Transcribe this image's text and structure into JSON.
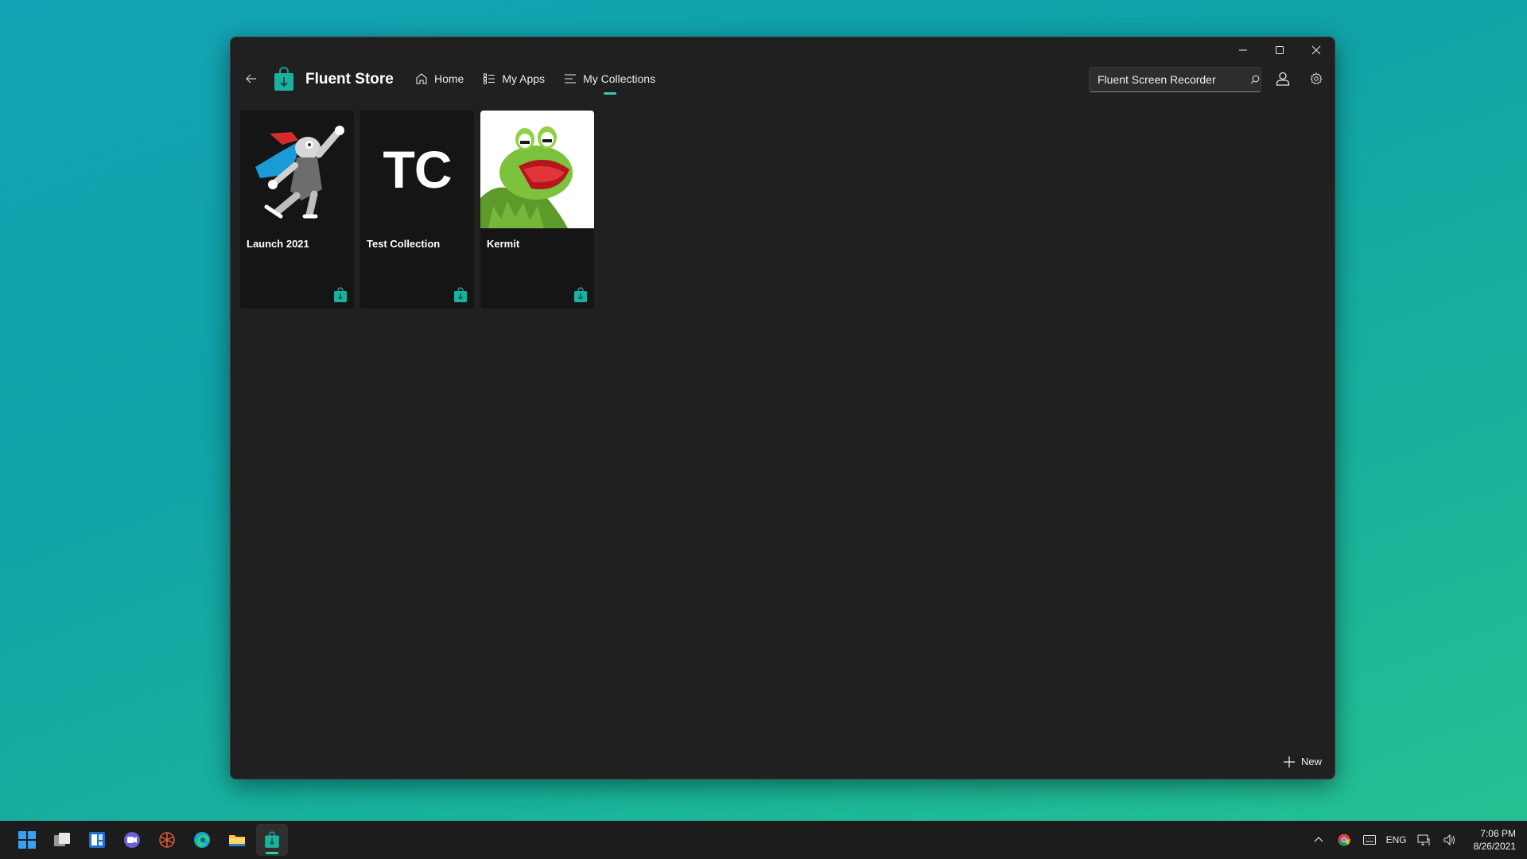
{
  "app": {
    "title": "Fluent Store",
    "back_icon": "arrow-left-icon",
    "logo_icon": "store-bag-icon",
    "accent": "#3ec7b7"
  },
  "nav": {
    "items": [
      {
        "label": "Home",
        "icon": "home-icon",
        "active": false
      },
      {
        "label": "My Apps",
        "icon": "app-list-icon",
        "active": false
      },
      {
        "label": "My Collections",
        "icon": "collections-icon",
        "active": true
      }
    ]
  },
  "search": {
    "value": "Fluent Screen Recorder",
    "icon": "search-icon"
  },
  "collections": [
    {
      "title": "Launch 2021",
      "image": "superhero-mascot"
    },
    {
      "title": "Test Collection",
      "image_text": "TC"
    },
    {
      "title": "Kermit",
      "image": "frog-photo"
    }
  ],
  "actions": {
    "new_label": "New"
  },
  "taskbar": {
    "tray": {
      "language": "ENG",
      "time": "7:06 PM",
      "date": "8/26/2021"
    }
  }
}
